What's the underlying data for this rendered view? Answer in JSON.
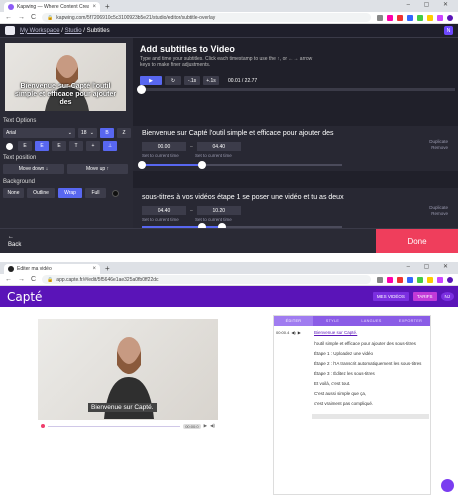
{
  "kapwing": {
    "tab_title": "Kapwing — Where Content Crea",
    "url": "kapwing.com/5f7206910c5c3100923b5e21/studio/editor/subtitle-overlay",
    "breadcrumb": {
      "workspace": "My Workspace",
      "sep1": " / ",
      "studio": "Studio",
      "sep2": " / ",
      "current": "Subtitles"
    },
    "avatar": "N",
    "video_subtitle": "Bienvenue sur Capté l'outil simple et efficace pour ajouter des",
    "text_options": {
      "heading": "Text Options",
      "font": "Arial",
      "size": "18",
      "bold": "B",
      "italic": "Z",
      "align_items": [
        "E",
        "E",
        "E",
        "T",
        "+",
        "⊥"
      ],
      "position_heading": "Text position",
      "move_down": "Move down ↓",
      "move_up": "Move up ↑",
      "background_heading": "Background",
      "bg_options": [
        "None",
        "Outline",
        "Wrap",
        "Full"
      ]
    },
    "main": {
      "title": "Add subtitles to Video",
      "description": "Type and time your subtitles. Click each timestamp to use the ↑, or ←→ arrow keys to make finer adjustments.",
      "controls": [
        "▶",
        "↻",
        "-.1s",
        "+.1s"
      ],
      "time": "00.01 / 22.77"
    },
    "subtitles": [
      {
        "text": "Bienvenue sur Capté l'outil simple et efficace pour ajouter des",
        "start": "00.00",
        "end": "04.40",
        "set_start": "Set to current time",
        "set_end": "Set to current time",
        "dup": "Duplicate",
        "remove": "Remove",
        "fill": 0.3
      },
      {
        "text": "sous-titres à vos vidéos étape 1 se poser une vidéo et tu as deux",
        "start": "04.40",
        "end": "10.20",
        "set_start": "Set to current time",
        "set_end": "Set to current time",
        "dup": "Duplicate",
        "remove": "Remove",
        "fill": 0.4
      }
    ],
    "footer": {
      "back_arrow": "←",
      "back": "Back",
      "done": "Done"
    }
  },
  "capte": {
    "tab_title": "Éditer ma vidéo",
    "url": "app.capte.fr/#/edit/5f5646e1ae325a0fb0ff22dc",
    "logo": "Capté",
    "header_buttons": [
      "MES VIDÉOS",
      "TARIFS",
      "NJ"
    ],
    "video_subtitle": "Bienvenue sur Capté.",
    "video_time": "00:00:0",
    "panel_tabs": [
      "ÉDITER",
      "STYLE",
      "LANGUES",
      "EXPORTER"
    ],
    "current_time": "00:00.4",
    "lines": [
      "Bienvenue sur Capté.",
      "l'outil simple et efficace pour ajouter des sous-titres",
      "Étape 1 : Uploadez une vidéo",
      "Étape 2 : l'IA transcrit automatiquement les sous-titres",
      "Étape 3 : Éditez les sous-titres",
      "Et voilà, c'est tout.",
      "C'est aussi simple que ça,",
      "c'est vraiment pas compliqué."
    ]
  },
  "colors": {
    "kap_accent": "#5867f0",
    "kap_done": "#ef3e5c",
    "capte_purple": "#5a14b8"
  }
}
